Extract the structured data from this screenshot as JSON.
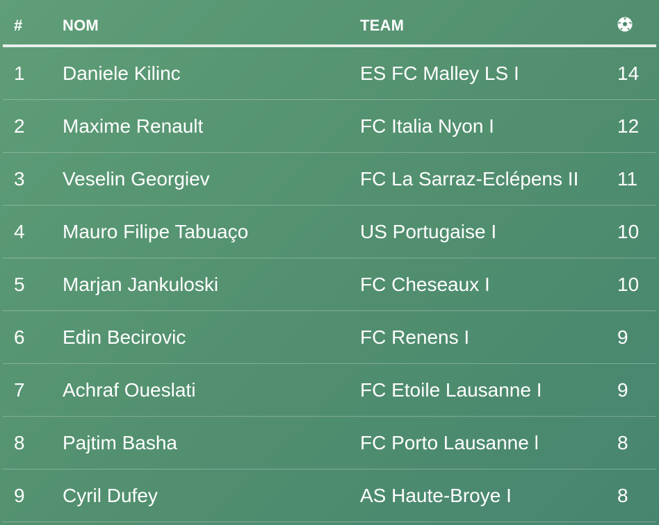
{
  "table": {
    "headers": {
      "rank": "#",
      "name": "NOM",
      "team": "TEAM",
      "goals_icon": "soccer-ball-icon"
    },
    "rows": [
      {
        "rank": "1",
        "name": "Daniele Kilinc",
        "team": "ES FC Malley LS I",
        "goals": "14"
      },
      {
        "rank": "2",
        "name": "Maxime Renault",
        "team": "FC Italia Nyon I",
        "goals": "12"
      },
      {
        "rank": "3",
        "name": "Veselin Georgiev",
        "team": "FC La Sarraz-Eclépens II",
        "goals": "11"
      },
      {
        "rank": "4",
        "name": "Mauro Filipe Tabuaço",
        "team": "US Portugaise I",
        "goals": "10"
      },
      {
        "rank": "5",
        "name": "Marjan Jankuloski",
        "team": "FC Cheseaux I",
        "goals": "10"
      },
      {
        "rank": "6",
        "name": "Edin Becirovic",
        "team": "FC Renens I",
        "goals": "9"
      },
      {
        "rank": "7",
        "name": "Achraf Oueslati",
        "team": "FC Etoile Lausanne I",
        "goals": "9"
      },
      {
        "rank": "8",
        "name": "Pajtim Basha",
        "team": "FC Porto Lausanne l",
        "goals": "8"
      },
      {
        "rank": "9",
        "name": "Cyril Dufey",
        "team": "AS Haute-Broye I",
        "goals": "8"
      }
    ]
  },
  "colors": {
    "background_start": "#5f9e78",
    "background_end": "#47856f",
    "text": "#ffffff"
  }
}
